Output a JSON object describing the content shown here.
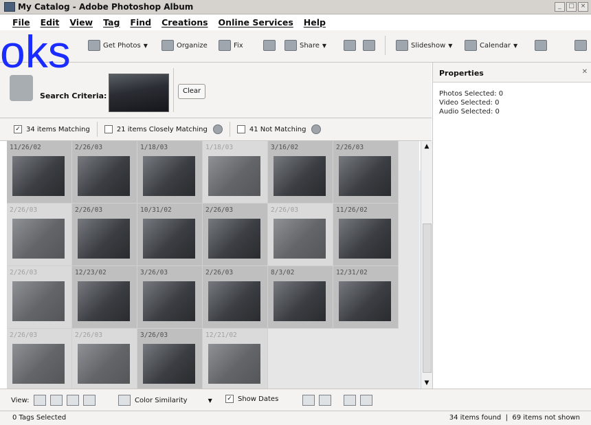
{
  "window": {
    "title": "My Catalog - Adobe Photoshop Album"
  },
  "menu": [
    "File",
    "Edit",
    "View",
    "Tag",
    "Find",
    "Creations",
    "Online Services",
    "Help"
  ],
  "toolbar": {
    "get_photos": "Get Photos",
    "organize": "Organize",
    "fix": "Fix",
    "share": "Share",
    "slideshow": "Slideshow",
    "calendar": "Calendar"
  },
  "watermark": "oks",
  "search": {
    "label": "Search Criteria:",
    "clear": "Clear"
  },
  "matches": {
    "matching": "34 items Matching",
    "closely": "21 items Closely Matching",
    "not_matching": "41 Not Matching"
  },
  "properties": {
    "title": "Properties",
    "photos": "Photos Selected: 0",
    "video": "Video Selected: 0",
    "audio": "Audio Selected: 0"
  },
  "photos": [
    {
      "date": "11/26/02"
    },
    {
      "date": "2/26/03"
    },
    {
      "date": "1/18/03"
    },
    {
      "date": "1/18/03"
    },
    {
      "date": "3/16/02"
    },
    {
      "date": "2/26/03"
    },
    {
      "date": "2/26/03"
    },
    {
      "date": "2/26/03"
    },
    {
      "date": "10/31/02"
    },
    {
      "date": "2/26/03"
    },
    {
      "date": "2/26/03"
    },
    {
      "date": "11/26/02"
    },
    {
      "date": "2/26/03"
    },
    {
      "date": "12/23/02"
    },
    {
      "date": "3/26/03"
    },
    {
      "date": "2/26/03"
    },
    {
      "date": "8/3/02"
    },
    {
      "date": "12/31/02"
    },
    {
      "date": "2/26/03"
    },
    {
      "date": "2/26/03"
    },
    {
      "date": "3/26/03"
    },
    {
      "date": "12/21/02"
    }
  ],
  "viewbar": {
    "view_label": "View:",
    "color_similarity": "Color Similarity",
    "show_dates": "Show Dates"
  },
  "status": {
    "tags": "0 Tags Selected",
    "found": "34 items found",
    "not_shown": "69 items not shown"
  }
}
